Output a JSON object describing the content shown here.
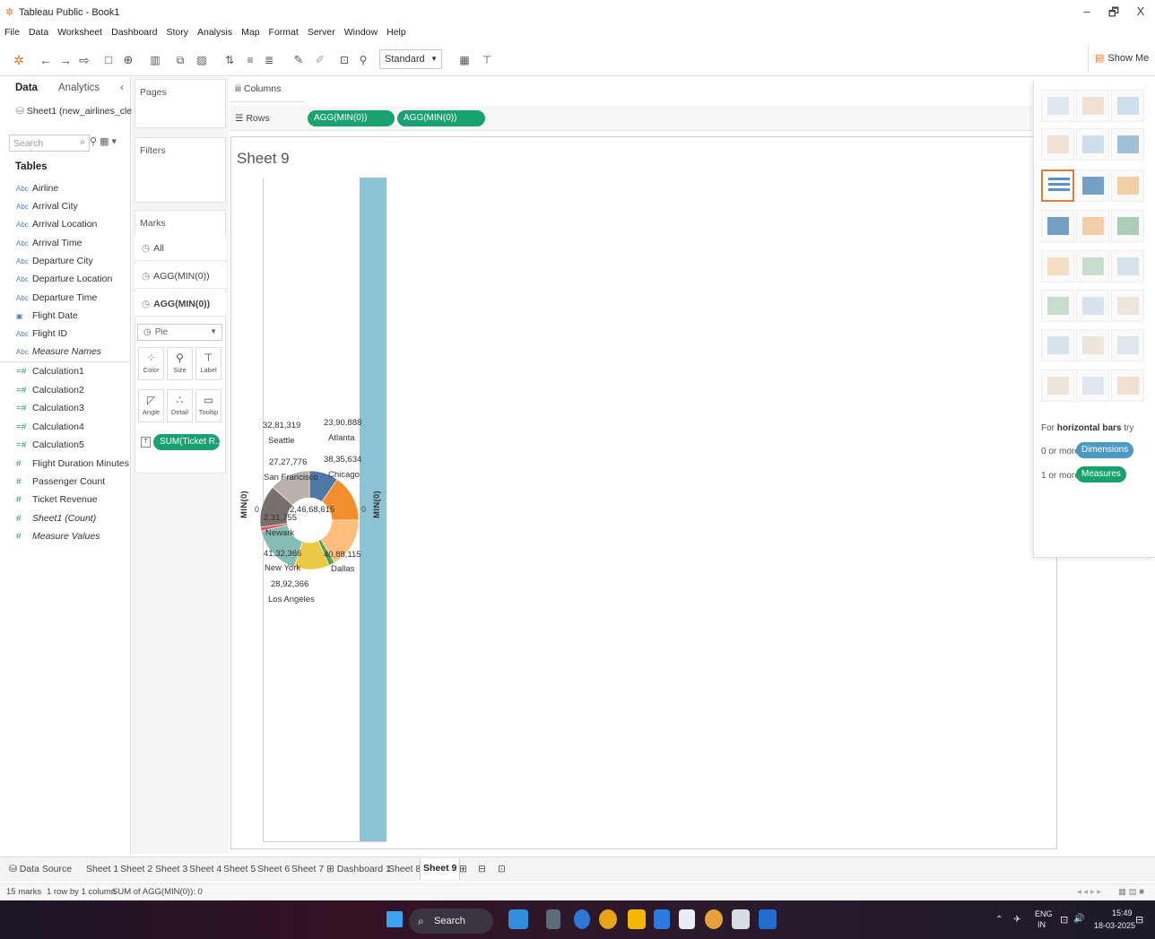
{
  "window": {
    "title": "Tableau Public - Book1",
    "min": "–",
    "restore": "🗗",
    "close": "X"
  },
  "menu": [
    "File",
    "Data",
    "Worksheet",
    "Dashboard",
    "Story",
    "Analysis",
    "Map",
    "Format",
    "Server",
    "Window",
    "Help"
  ],
  "toolbar": {
    "fit_select": "Standard",
    "show_me": "Show Me"
  },
  "data_pane": {
    "tab_data": "Data",
    "tab_analytics": "Analytics",
    "collapse": "‹",
    "datasource": "Sheet1 (new_airlines_cle...",
    "search_placeholder": "Search",
    "tables_header": "Tables",
    "fields": [
      {
        "type": "Abc",
        "name": "Airline"
      },
      {
        "type": "Abc",
        "name": "Arrival City"
      },
      {
        "type": "Abc",
        "name": "Arrival Location"
      },
      {
        "type": "Abc",
        "name": "Arrival Time"
      },
      {
        "type": "Abc",
        "name": "Departure City"
      },
      {
        "type": "Abc",
        "name": "Departure Location"
      },
      {
        "type": "Abc",
        "name": "Departure Time"
      },
      {
        "type": "date",
        "name": "Flight Date"
      },
      {
        "type": "Abc",
        "name": "Flight ID"
      },
      {
        "type": "Abc",
        "name": "Measure Names"
      },
      {
        "type": "calc",
        "name": "Calculation1"
      },
      {
        "type": "calc",
        "name": "Calculation2"
      },
      {
        "type": "calc",
        "name": "Calculation3"
      },
      {
        "type": "calc",
        "name": "Calculation4"
      },
      {
        "type": "calc",
        "name": "Calculation5"
      },
      {
        "type": "#",
        "name": "Flight Duration Minutes"
      },
      {
        "type": "#",
        "name": "Passenger Count"
      },
      {
        "type": "#",
        "name": "Ticket Revenue"
      },
      {
        "type": "#",
        "name": "Sheet1 (Count)"
      },
      {
        "type": "#",
        "name": "Measure Values"
      }
    ]
  },
  "cards": {
    "pages": "Pages",
    "filters": "Filters",
    "marks": "Marks",
    "marks_rows": [
      "All",
      "AGG(MIN(0))",
      "AGG(MIN(0))"
    ],
    "mark_type": "Pie",
    "mark_buttons": [
      "Color",
      "Size",
      "Label",
      "Angle",
      "Detail",
      "Tooltip"
    ],
    "label_pill": "SUM(Ticket R..",
    "label_pill_icon": "T"
  },
  "shelves": {
    "columns_label": "Columns",
    "rows_label": "Rows",
    "rows_pills": [
      "AGG(MIN(0))",
      "AGG(MIN(0))"
    ]
  },
  "sheet": {
    "title": "Sheet 9",
    "axis_left": "MIN(0)",
    "axis_right": "MIN(0)",
    "tick_left": "0",
    "tick_right": "0",
    "center_value": "2,46,68,615",
    "slices": [
      {
        "city": "Atlanta",
        "value": "23,90,888",
        "color": "#4e79a7"
      },
      {
        "city": "Chicago",
        "value": "38,35,634",
        "color": "#f28e2b"
      },
      {
        "city": "Dallas",
        "value": "40,88,115",
        "color": "#ffbe7d"
      },
      {
        "city": "",
        "value": "",
        "color": "#59a14f"
      },
      {
        "city": "Los Angeles",
        "value": "28,92,366",
        "color": "#edc948"
      },
      {
        "city": "New York",
        "value": "41,32,366",
        "color": "#86bcb6"
      },
      {
        "city": "Newark",
        "value": "2,31,755",
        "color": "#e15759"
      },
      {
        "city": "San Francisco",
        "value": "27,27,776",
        "color": "#79706e"
      },
      {
        "city": "Seattle",
        "value": "32,81,319",
        "color": "#bab0ac"
      }
    ]
  },
  "show_me": {
    "hint_prefix": "For",
    "hint_bold": "horizontal bars",
    "hint_suffix": "try",
    "dims_prefix": "0 or more",
    "dims_pill": "Dimensions",
    "meas_prefix": "1 or more",
    "meas_pill": "Measures"
  },
  "tabs": {
    "data_source": "Data Source",
    "sheets": [
      "Sheet 1",
      "Sheet 2",
      "Sheet 3",
      "Sheet 4",
      "Sheet 5",
      "Sheet 6",
      "Sheet 7"
    ],
    "dashboard": "Dashboard 1",
    "sheet8": "Sheet 8",
    "active": "Sheet 9"
  },
  "status": {
    "marks": "15 marks",
    "rows": "1 row by 1 column",
    "sum": "SUM of AGG(MIN(0)): 0"
  },
  "taskbar": {
    "search": "Search",
    "lang": "ENG",
    "region": "IN",
    "time": "15:49",
    "date": "18-03-2025"
  },
  "colors": {
    "accent_green": "#1aa170",
    "axis_bar": "#8cc4d5",
    "selected_border": "#e07b39",
    "dims_pill": "#4a9bc4"
  }
}
